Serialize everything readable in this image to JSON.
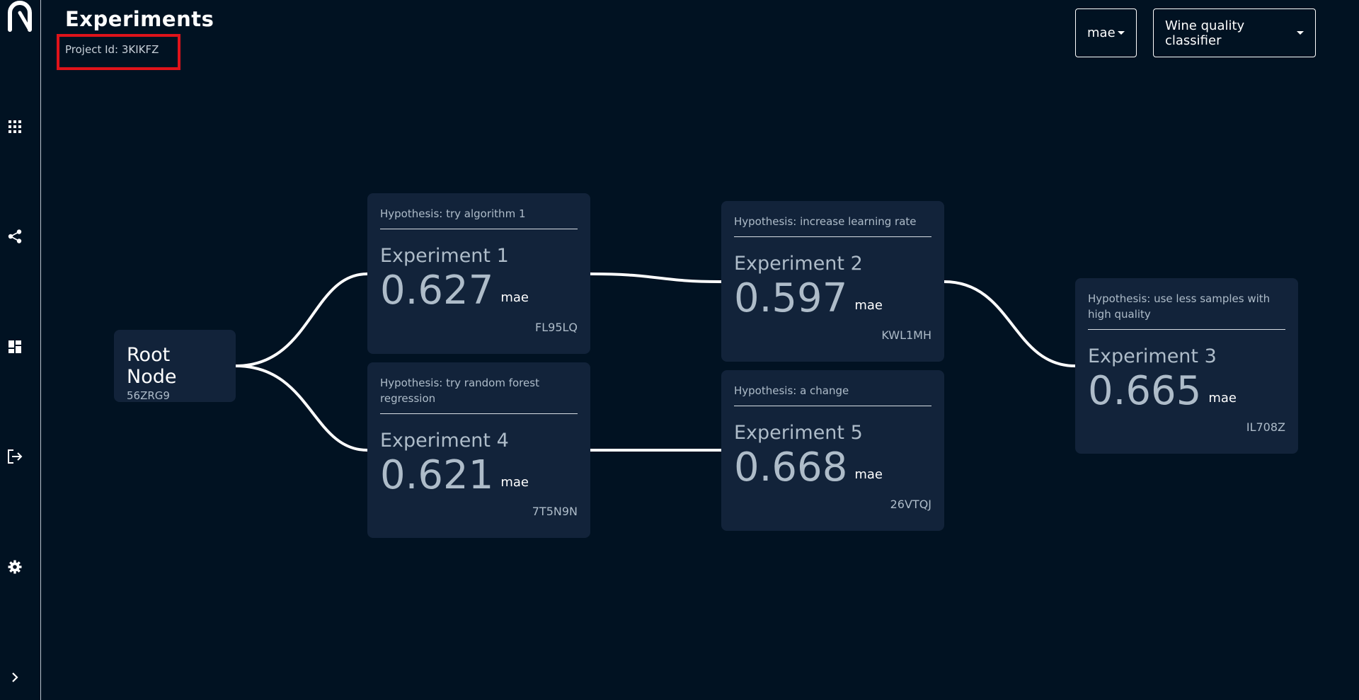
{
  "sidebar": {
    "items": [
      {
        "icon": "apps-grid-icon"
      },
      {
        "icon": "share-icon"
      },
      {
        "icon": "dashboard-icon"
      },
      {
        "icon": "logout-icon"
      },
      {
        "icon": "gear-icon"
      },
      {
        "icon": "chevron-right-icon"
      }
    ]
  },
  "header": {
    "title": "Experiments",
    "project_id": "Project Id: 3KIKFZ"
  },
  "controls": {
    "metric_selected": "mae",
    "project_selected": "Wine quality classifier"
  },
  "root_node": {
    "name": "Root Node",
    "id": "56ZRG9"
  },
  "experiments": [
    {
      "hypothesis": "Hypothesis: try algorithm 1",
      "name": "Experiment 1",
      "value": "0.627",
      "unit": "mae",
      "id": "FL95LQ"
    },
    {
      "hypothesis": "Hypothesis: increase learning rate",
      "name": "Experiment 2",
      "value": "0.597",
      "unit": "mae",
      "id": "KWL1MH"
    },
    {
      "hypothesis": "Hypothesis: use less samples with high quality",
      "name": "Experiment 3",
      "value": "0.665",
      "unit": "mae",
      "id": "IL708Z"
    },
    {
      "hypothesis": "Hypothesis: try random forest regression",
      "name": "Experiment 4",
      "value": "0.621",
      "unit": "mae",
      "id": "7T5N9N"
    },
    {
      "hypothesis": "Hypothesis: a change",
      "name": "Experiment 5",
      "value": "0.668",
      "unit": "mae",
      "id": "26VTQJ"
    }
  ],
  "colors": {
    "background": "#011222",
    "card": "#12233a",
    "highlight": "#e0131a"
  }
}
